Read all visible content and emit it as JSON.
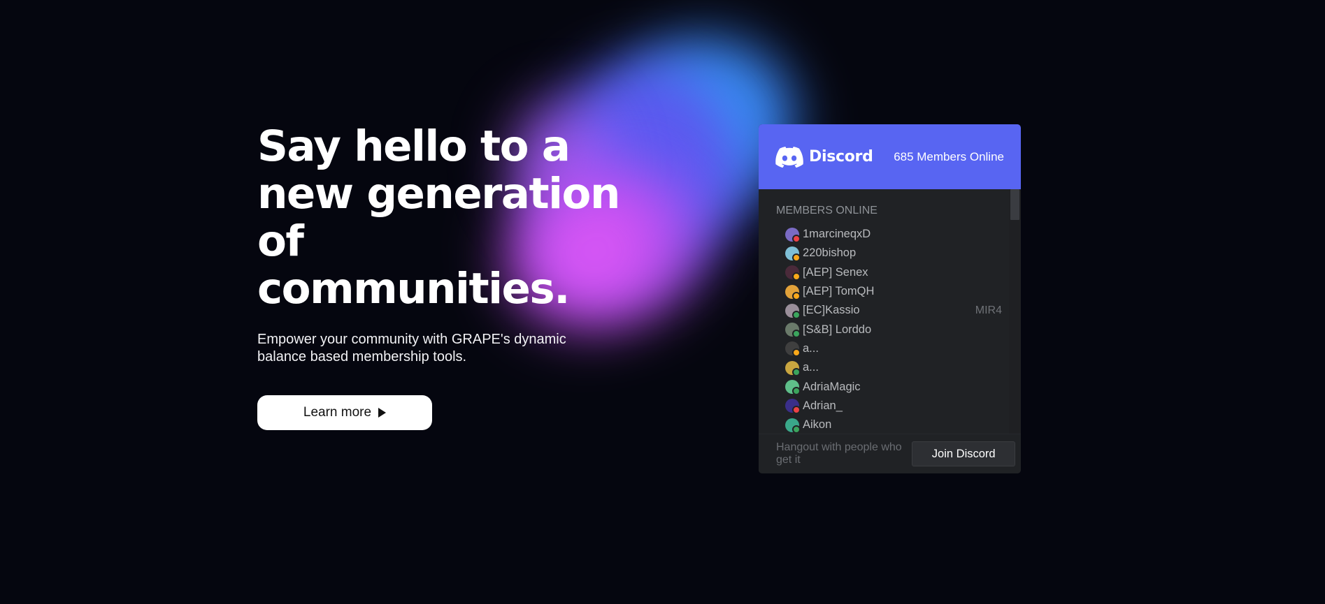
{
  "hero": {
    "title": "Say hello to a\nnew generation\nof communities.",
    "subtitle": "Empower your community with GRAPE's dynamic\nbalance based membership tools.",
    "cta_label": "Learn more",
    "cta_icon": "play-icon"
  },
  "discord_widget": {
    "brand": "Discord",
    "logo_icon": "discord-logo-icon",
    "online_count_label": "685 Members Online",
    "section_label": "MEMBERS ONLINE",
    "members": [
      {
        "name": "1marcineqxD",
        "game": "",
        "avatar_color": "#7a6bc4",
        "status_color": "#ed4245"
      },
      {
        "name": "220bishop",
        "game": "",
        "avatar_color": "#7fbfd6",
        "status_color": "#faa81a"
      },
      {
        "name": "[AEP] Senex",
        "game": "",
        "avatar_color": "#4a2a3a",
        "status_color": "#faa81a"
      },
      {
        "name": "[AEP] TomQH",
        "game": "",
        "avatar_color": "#e2a23a",
        "status_color": "#faa81a"
      },
      {
        "name": "[EC]Kassio",
        "game": "MIR4",
        "avatar_color": "#9a8f9a",
        "status_color": "#3ba55d"
      },
      {
        "name": "[S&B] Lorddo",
        "game": "",
        "avatar_color": "#6a7a6a",
        "status_color": "#3ba55d"
      },
      {
        "name": "a...",
        "game": "",
        "avatar_color": "#3f3f3f",
        "status_color": "#faa81a"
      },
      {
        "name": "a...",
        "game": "",
        "avatar_color": "#c9a640",
        "status_color": "#3ba55d"
      },
      {
        "name": "AdriaMagic",
        "game": "",
        "avatar_color": "#5fbf8a",
        "status_color": "#3ba55d"
      },
      {
        "name": "Adrian_",
        "game": "",
        "avatar_color": "#3a2f8a",
        "status_color": "#ed4245"
      },
      {
        "name": "Aikon",
        "game": "",
        "avatar_color": "#3aa88a",
        "status_color": "#3ba55d"
      }
    ],
    "footer_text": "Hangout with people who get it",
    "join_label": "Join Discord"
  },
  "colors": {
    "background": "#05060f",
    "discord_blurple": "#5865f2",
    "widget_bg": "#202225"
  }
}
